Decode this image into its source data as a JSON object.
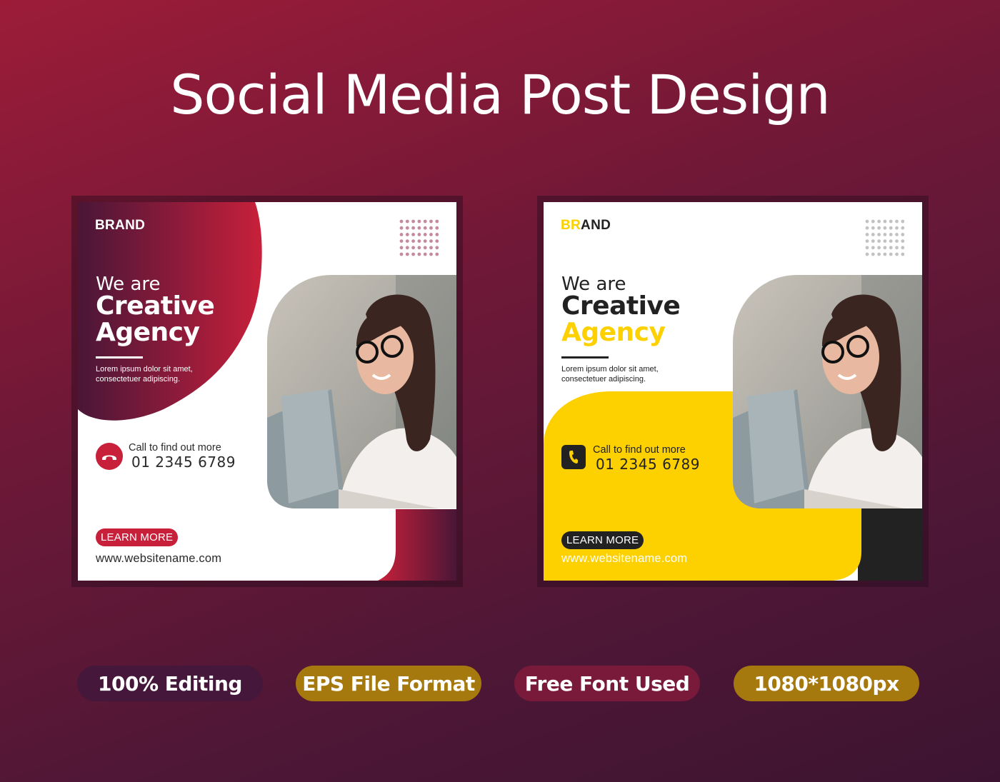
{
  "page_title": "Social Media Post Design",
  "colors": {
    "background_top": "#9c1c38",
    "background_bottom": "#3c1431",
    "crimson": "#c8203a",
    "plum": "#4a1637",
    "yellow": "#fdd000",
    "dark": "#222222"
  },
  "posts": [
    {
      "variant": "red",
      "brand": "BRAND",
      "headline_intro": "We are",
      "headline_main": "Creative",
      "headline_accent": "Agency",
      "body_text": "Lorem ipsum dolor sit amet, consectetuer adipiscing.",
      "call_label": "Call to find out more",
      "phone": "01 2345 6789",
      "phone_icon": "phone-handset-icon",
      "button_label": "LEARN MORE",
      "website": "www.websitename.com",
      "photo_alt": "woman with glasses smiling at laptop"
    },
    {
      "variant": "yellow",
      "brand_part1": "BR",
      "brand_part2": "AND",
      "headline_intro": "We are",
      "headline_main": "Creative",
      "headline_accent": "Agency",
      "body_text": "Lorem ipsum dolor sit amet, consectetuer adipiscing.",
      "call_label": "Call to find out more",
      "phone": "01 2345 6789",
      "phone_icon": "phone-icon",
      "button_label": "LEARN MORE",
      "website": "www.websitename.com",
      "photo_alt": "woman with glasses smiling at laptop"
    }
  ],
  "badges": [
    {
      "label": "100% Editing",
      "color": "#45173a"
    },
    {
      "label": "EPS File Format",
      "color": "#a6790e"
    },
    {
      "label": "Free Font Used",
      "color": "#7a1a3a"
    },
    {
      "label": "1080*1080px",
      "color": "#a6790e"
    }
  ]
}
